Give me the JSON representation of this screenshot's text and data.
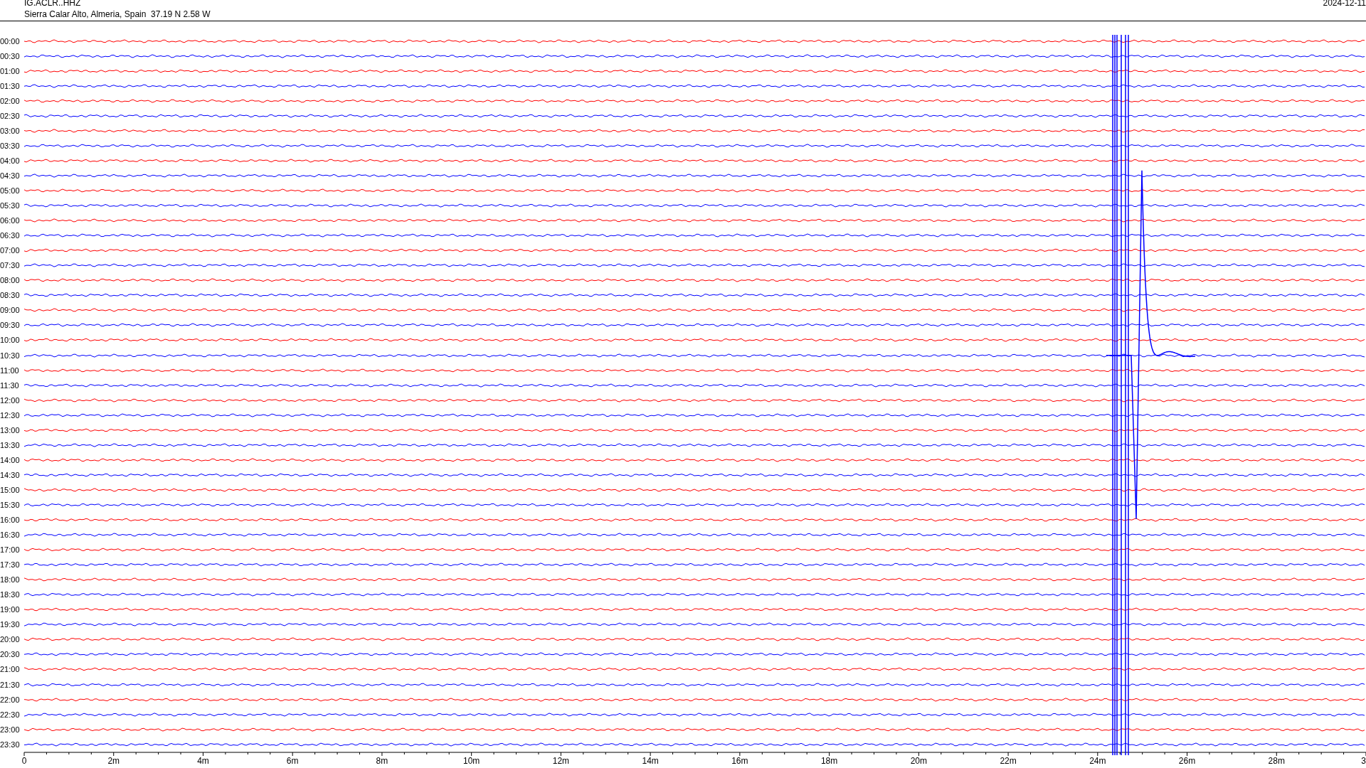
{
  "header": {
    "station": "IG.ACLR..HHZ",
    "location": "Sierra Calar Alto, Almeria, Spain  37.19 N 2.58 W",
    "date": "2024-12-11"
  },
  "rows": [
    {
      "time": "00:00",
      "color": "#ff0000"
    },
    {
      "time": "00:30",
      "color": "#0000ff"
    },
    {
      "time": "01:00",
      "color": "#ff0000"
    },
    {
      "time": "01:30",
      "color": "#0000ff"
    },
    {
      "time": "02:00",
      "color": "#ff0000"
    },
    {
      "time": "02:30",
      "color": "#0000ff"
    },
    {
      "time": "03:00",
      "color": "#ff0000"
    },
    {
      "time": "03:30",
      "color": "#0000ff"
    },
    {
      "time": "04:00",
      "color": "#ff0000"
    },
    {
      "time": "04:30",
      "color": "#0000ff"
    },
    {
      "time": "05:00",
      "color": "#ff0000"
    },
    {
      "time": "05:30",
      "color": "#0000ff"
    },
    {
      "time": "06:00",
      "color": "#ff0000"
    },
    {
      "time": "06:30",
      "color": "#0000ff"
    },
    {
      "time": "07:00",
      "color": "#ff0000"
    },
    {
      "time": "07:30",
      "color": "#0000ff"
    },
    {
      "time": "08:00",
      "color": "#ff0000"
    },
    {
      "time": "08:30",
      "color": "#0000ff"
    },
    {
      "time": "09:00",
      "color": "#ff0000"
    },
    {
      "time": "09:30",
      "color": "#0000ff"
    },
    {
      "time": "10:00",
      "color": "#ff0000"
    },
    {
      "time": "10:30",
      "color": "#0000ff"
    },
    {
      "time": "11:00",
      "color": "#ff0000"
    },
    {
      "time": "11:30",
      "color": "#0000ff"
    },
    {
      "time": "12:00",
      "color": "#ff0000"
    },
    {
      "time": "12:30",
      "color": "#0000ff"
    },
    {
      "time": "13:00",
      "color": "#ff0000"
    },
    {
      "time": "13:30",
      "color": "#0000ff"
    },
    {
      "time": "14:00",
      "color": "#ff0000"
    },
    {
      "time": "14:30",
      "color": "#0000ff"
    },
    {
      "time": "15:00",
      "color": "#ff0000"
    },
    {
      "time": "15:30",
      "color": "#0000ff"
    },
    {
      "time": "16:00",
      "color": "#ff0000"
    },
    {
      "time": "16:30",
      "color": "#0000ff"
    },
    {
      "time": "17:00",
      "color": "#ff0000"
    },
    {
      "time": "17:30",
      "color": "#0000ff"
    },
    {
      "time": "18:00",
      "color": "#ff0000"
    },
    {
      "time": "18:30",
      "color": "#0000ff"
    },
    {
      "time": "19:00",
      "color": "#ff0000"
    },
    {
      "time": "19:30",
      "color": "#0000ff"
    },
    {
      "time": "20:00",
      "color": "#ff0000"
    },
    {
      "time": "20:30",
      "color": "#0000ff"
    },
    {
      "time": "21:00",
      "color": "#ff0000"
    },
    {
      "time": "21:30",
      "color": "#0000ff"
    },
    {
      "time": "22:00",
      "color": "#ff0000"
    },
    {
      "time": "22:30",
      "color": "#0000ff"
    },
    {
      "time": "23:00",
      "color": "#ff0000"
    },
    {
      "time": "23:30",
      "color": "#0000ff"
    }
  ],
  "time_axis": {
    "labels": [
      "0",
      "2m",
      "4m",
      "6m",
      "8m",
      "10m",
      "12m",
      "14m",
      "16m",
      "18m",
      "20m",
      "22m",
      "24m",
      "26m",
      "28m",
      "3"
    ]
  }
}
